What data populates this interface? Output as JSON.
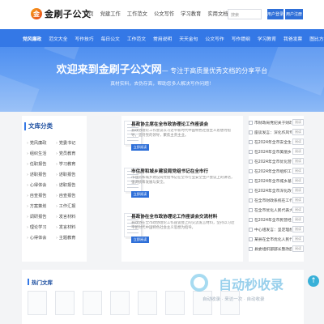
{
  "header": {
    "logo_mark": "金",
    "logo_text": "金刷子公文",
    "nav": [
      "首页",
      "党建工作",
      "工作范文",
      "公文写作",
      "学习教育",
      "实用文档"
    ],
    "search_placeholder": "搜索",
    "login_label": "用户登录",
    "register_label": "用户注册"
  },
  "bluenav": [
    "党风廉政",
    "范文大全",
    "写作技巧",
    "每日公文",
    "工作范文",
    "常用说明",
    "天天金句",
    "公文写作",
    "写作提纲",
    "学习教育",
    "我爸发票",
    "图比方案"
  ],
  "banner": {
    "title": "欢迎来到金刷子公文网",
    "subtitle": "— 专注于高质量优秀文档的分享平台",
    "desc": "真材实料，去伪存真，帮助您多人解决写作问题！"
  },
  "categories": {
    "title": "文库分类",
    "items": [
      "党风廉政",
      "党委书记",
      "组织生活",
      "党员教育",
      "任职报告",
      "学习教育",
      "述职报告",
      "述职报告",
      "心得体会",
      "述职报告",
      "自查报告",
      "自查报告",
      "方案策划",
      "工作汇报",
      "调研报告",
      "发言材料",
      "理论学习",
      "发言材料",
      "心得体会",
      "主题教育"
    ]
  },
  "articles": [
    {
      "title": "县政协主席在全市政协理论工作座谈会",
      "desc": "县政协理论工作会议以习近平新时代中国特色社会主义思想为指导，坚持党的领导，聚焦主责主业。",
      "button": "立即阅读"
    },
    {
      "title": "市住房和城乡建设局党组书记在全市行",
      "desc": "市住房和城乡建设局党组书记在全市行业安全生产会议上的讲话，强调统筹发展与安全。",
      "button": "立即阅读"
    },
    {
      "title": "县政协在全市政协理论工作座谈会交流材料",
      "desc": "县政协在全市政协理论工作座谈会上的交流发言材料，坚持以习近平新时代中国特色社会主义思想为指导。",
      "button": "立即阅读"
    }
  ],
  "right_list": [
    {
      "text": "市财政局党纪关于财政资金监督",
      "badge": "阅读"
    },
    {
      "text": "座谈发言：深化作风专项“五查”",
      "badge": "阅读"
    },
    {
      "text": "在2024年全市安全生产工作会议",
      "badge": "阅读"
    },
    {
      "text": "在2024年全市美丽乡村建设工作会",
      "badge": "阅读"
    },
    {
      "text": "在2024年全市优化营商环境工作部",
      "badge": "阅读"
    },
    {
      "text": "在2024年全市组织工作会议上的",
      "badge": "阅读"
    },
    {
      "text": "在2024年全市城乡基层治理会议",
      "badge": "阅读"
    },
    {
      "text": "在2024年全市深化改革工作部署",
      "badge": "阅读"
    },
    {
      "text": "在全市财政系统在工作座谈会上",
      "badge": "阅读"
    },
    {
      "text": "在全市优化人民代表大会第二次",
      "badge": "阅读"
    },
    {
      "text": "在2024年全市民营经济发展推进",
      "badge": "阅读"
    },
    {
      "text": "中心组发言：坚定理想信念，筑牢",
      "badge": "阅读"
    },
    {
      "text": "某县在全市优化人民代表大会第",
      "badge": "阅读"
    },
    {
      "text": "县委组织部部长整改面对面讲话",
      "badge": "阅读"
    }
  ],
  "hot": {
    "title": "热门文库",
    "cards": 8
  },
  "watermark": {
    "big": "自动秒收录",
    "small": "自动收录 · 来访一次 · 自动收录"
  },
  "totop_label": "↑"
}
